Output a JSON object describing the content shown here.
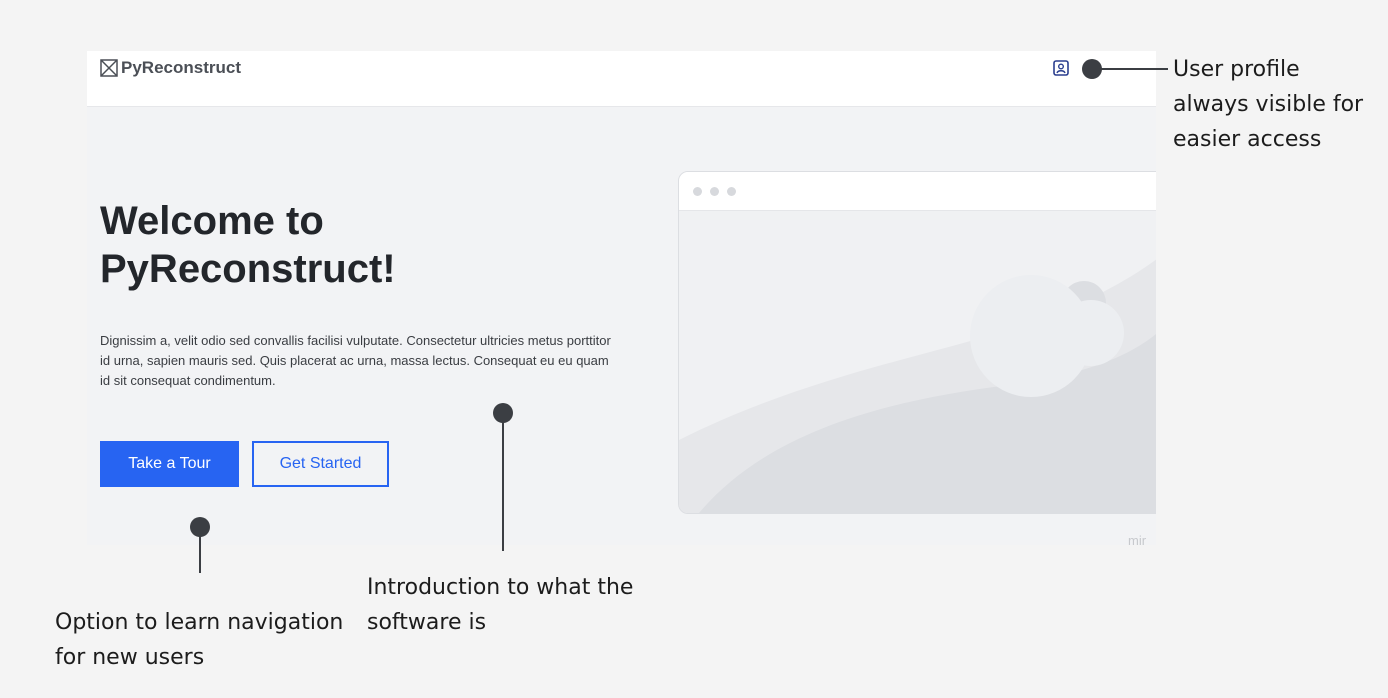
{
  "app": {
    "logo_text": "PyReconstruct",
    "logo_icon": "crossed-square-icon",
    "profile_icon": "user-profile-icon"
  },
  "hero": {
    "title": "Welcome to PyReconstruct!",
    "body": "Dignissim a, velit odio sed convallis facilisi vulputate. Consectetur ultricies metus porttitor id urna, sapien mauris sed. Quis placerat ac urna, massa lectus. Consequat eu eu quam id sit consequat condimentum.",
    "tour_label": "Take a Tour",
    "start_label": "Get Started"
  },
  "illustration": {
    "cut_text": "mir"
  },
  "annotations": {
    "profile": "User profile always visible for easier access",
    "intro": "Introduction to what the software is",
    "tour": "Option to learn navigation for new users"
  },
  "colors": {
    "accent": "#2764f2",
    "annotation_dot": "#3b3e43"
  }
}
